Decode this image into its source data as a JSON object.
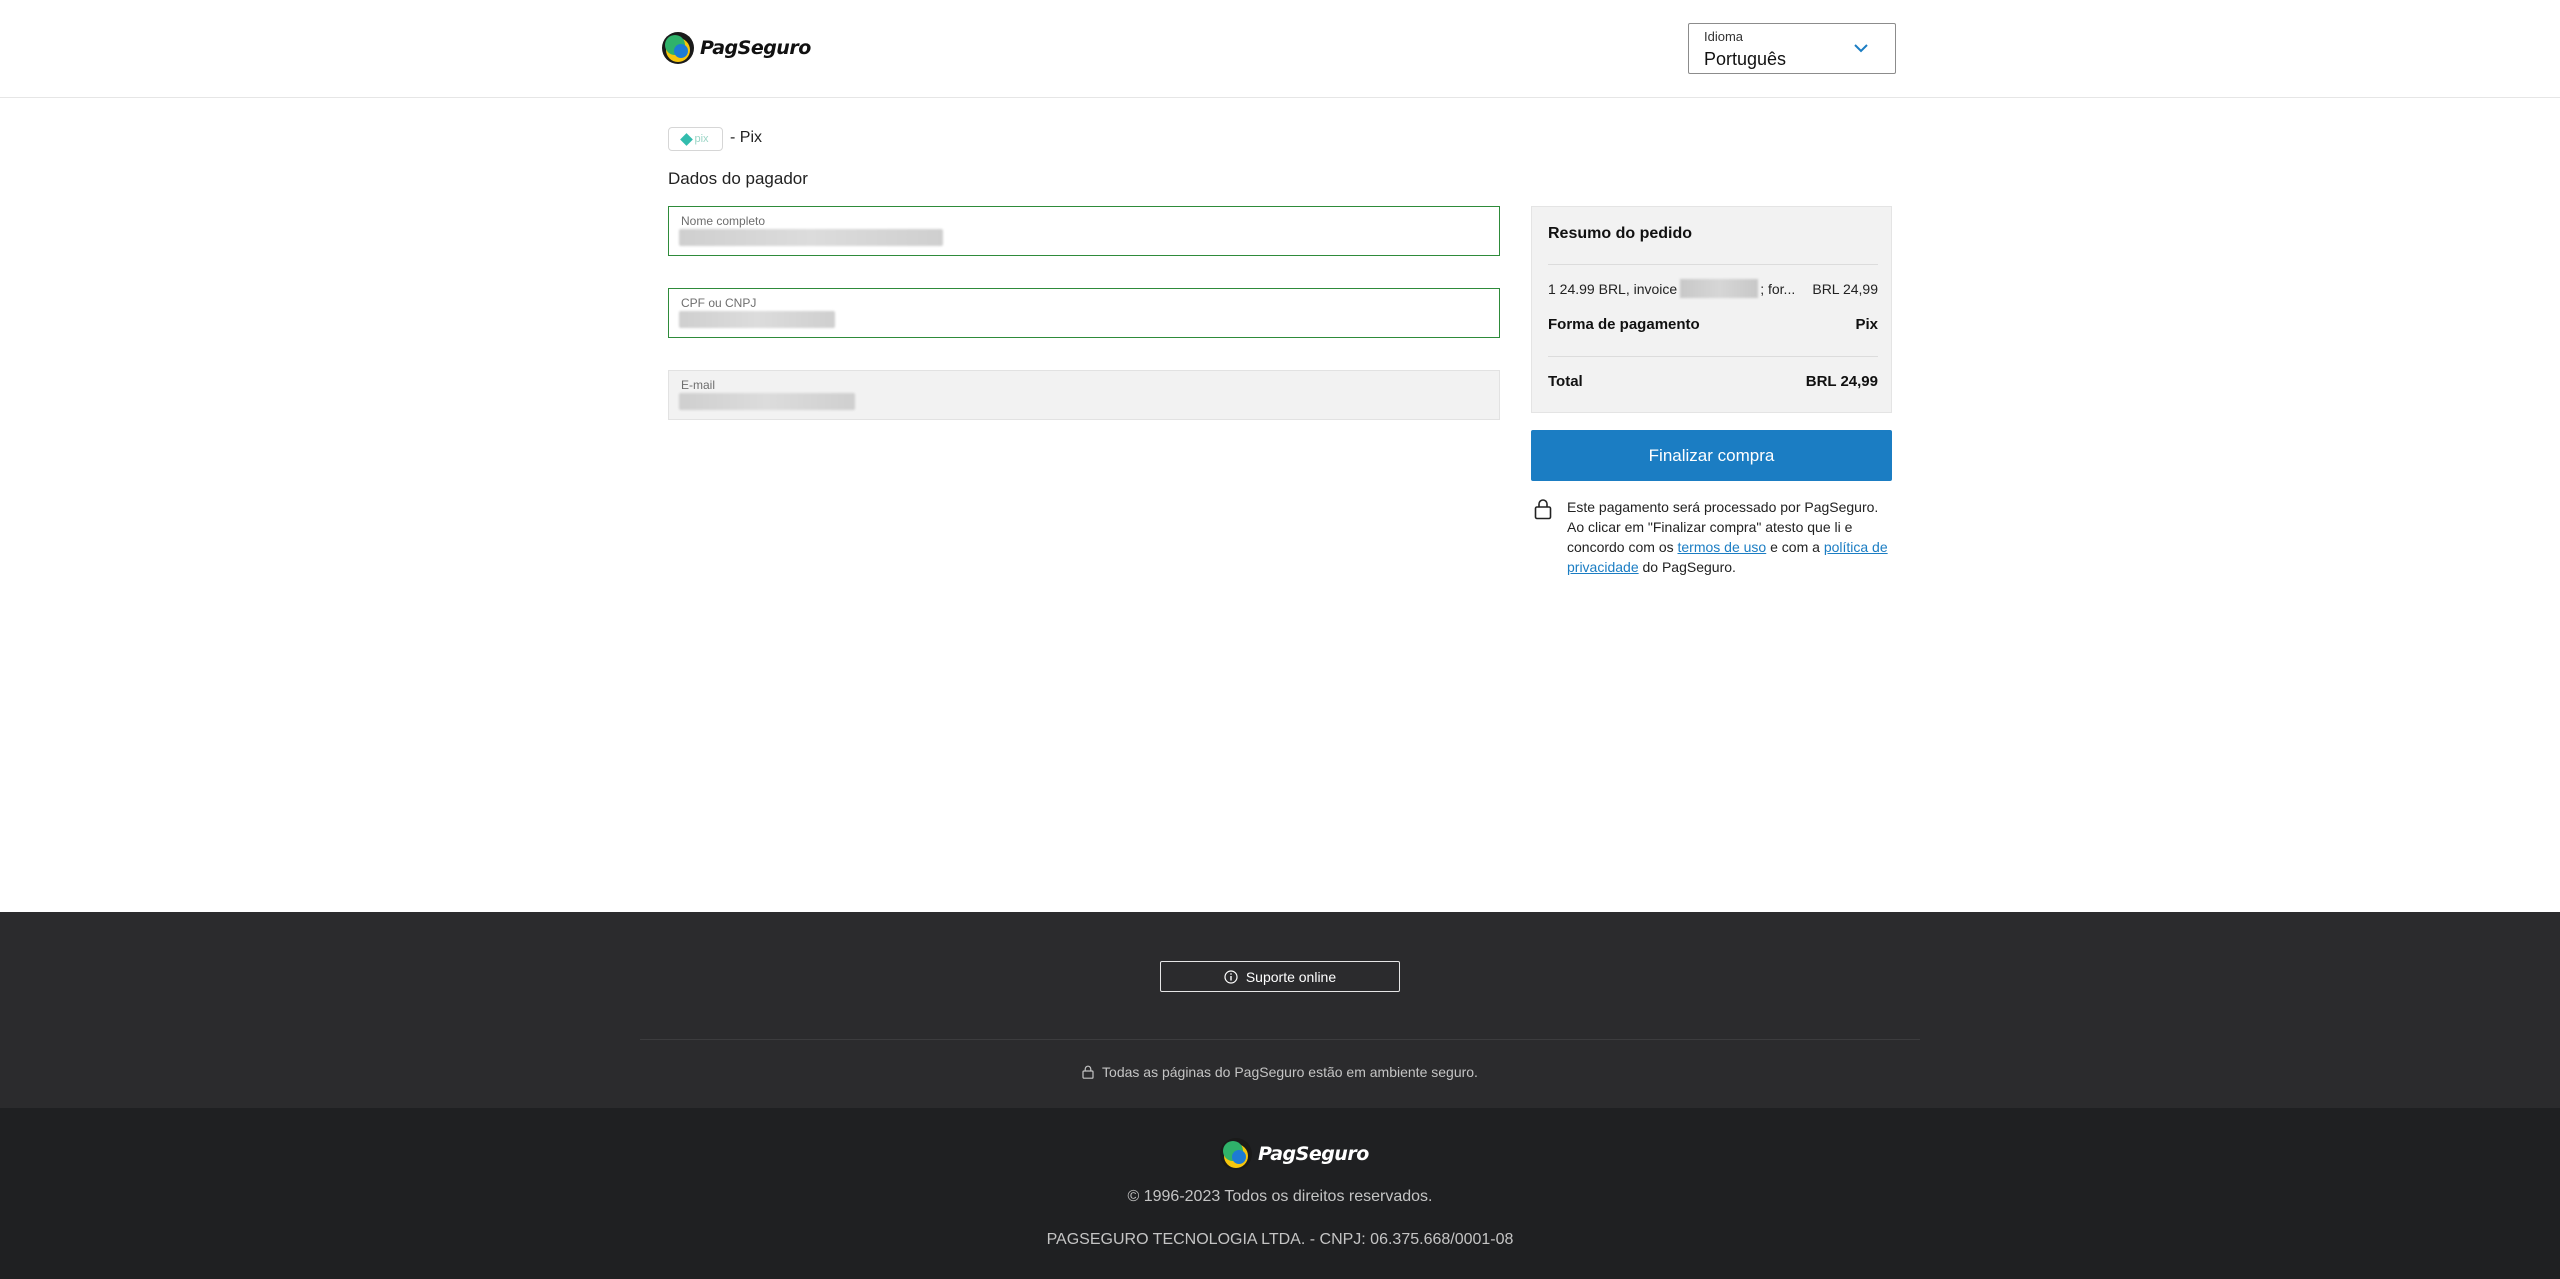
{
  "header": {
    "brand": "PagSeguro",
    "language": {
      "label": "Idioma",
      "value": "Português"
    }
  },
  "payment_method": {
    "name": "- Pix"
  },
  "form": {
    "title": "Dados do pagador",
    "fields": [
      {
        "label": "Nome completo"
      },
      {
        "label": "CPF ou CNPJ"
      },
      {
        "label": "E-mail"
      }
    ]
  },
  "summary": {
    "title": "Resumo do pedido",
    "item": {
      "desc_prefix": "1 24.99 BRL, invoice",
      "desc_suffix": "; for...",
      "amount": "BRL 24,99"
    },
    "payment": {
      "label": "Forma de pagamento",
      "value": "Pix"
    },
    "total": {
      "label": "Total",
      "value": "BRL 24,99"
    }
  },
  "checkout": {
    "button_label": "Finalizar compra",
    "note": {
      "text1": "Este pagamento será processado por PagSeguro. Ao clicar em \"Finalizar compra\" atesto que li e concordo com os ",
      "link_terms": "termos de uso",
      "text2": " e com a ",
      "link_privacy": "política de privacidade",
      "text3": " do PagSeguro."
    }
  },
  "footer": {
    "support_label": "Suporte online",
    "secure_text": "Todas as páginas do PagSeguro estão em ambiente seguro.",
    "brand": "PagSeguro",
    "copyright": "© 1996-2023 Todos os direitos reservados.",
    "company": "PAGSEGURO TECNOLOGIA LTDA. - CNPJ: 06.375.668/0001-08"
  },
  "colors": {
    "primary": "#1b7dc3",
    "valid_border": "#2e8b3a",
    "footer_top": "#2b2b2d",
    "footer_bottom": "#1f2022"
  }
}
